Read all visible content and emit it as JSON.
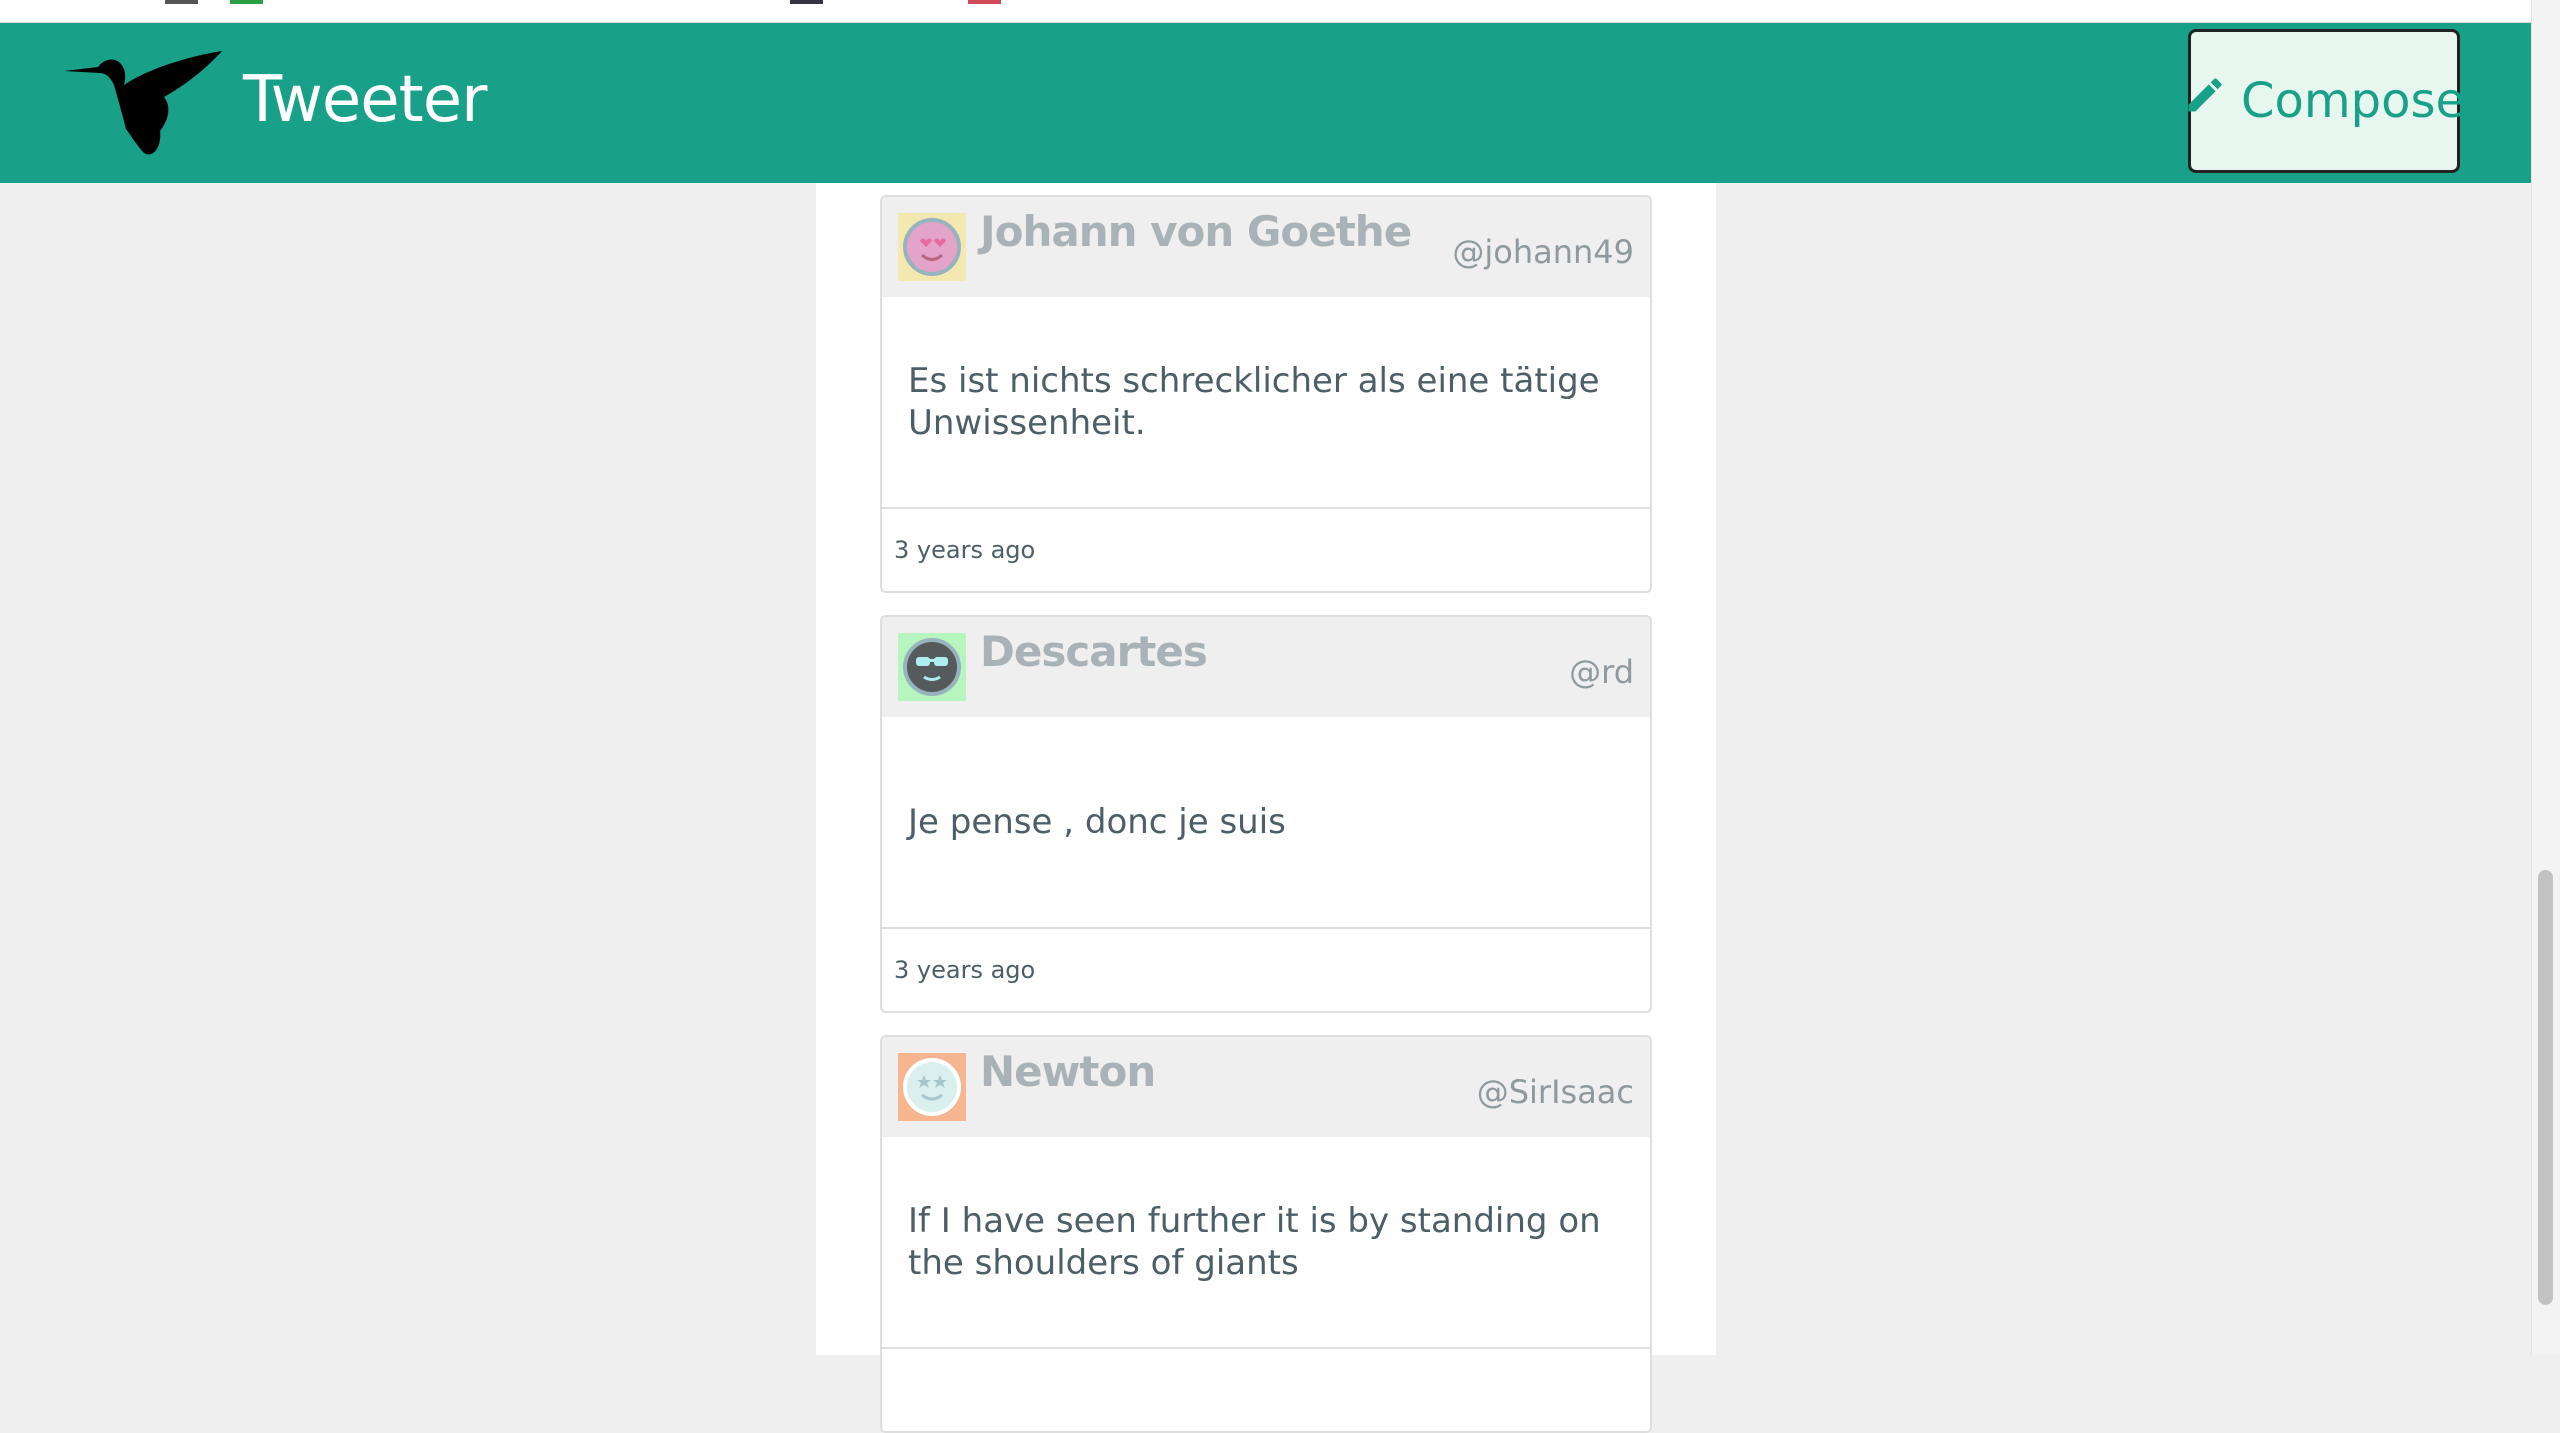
{
  "app": {
    "brand": "Tweeter",
    "compose_label": "Compose",
    "accent_color": "#18a089"
  },
  "icons": {
    "logo": "hummingbird-icon",
    "compose": "pencil-icon"
  },
  "tweets": [
    {
      "name": "Johann von Goethe",
      "handle": "@johann49",
      "text": "Es ist nichts schrecklicher als eine tätige Unwissenheit.",
      "time": "3 years ago",
      "avatar_icon": "love-eyes-face-icon",
      "avatar_bg": "#f3e8b0"
    },
    {
      "name": "Descartes",
      "handle": "@rd",
      "text": "Je pense , donc je suis",
      "time": "3 years ago",
      "avatar_icon": "sunglasses-face-icon",
      "avatar_bg": "#b7f5bf"
    },
    {
      "name": "Newton",
      "handle": "@SirIsaac",
      "text": "If I have seen further it is by standing on the shoulders of giants",
      "time": "",
      "avatar_icon": "star-eyes-face-icon",
      "avatar_bg": "#f7b58f"
    }
  ]
}
